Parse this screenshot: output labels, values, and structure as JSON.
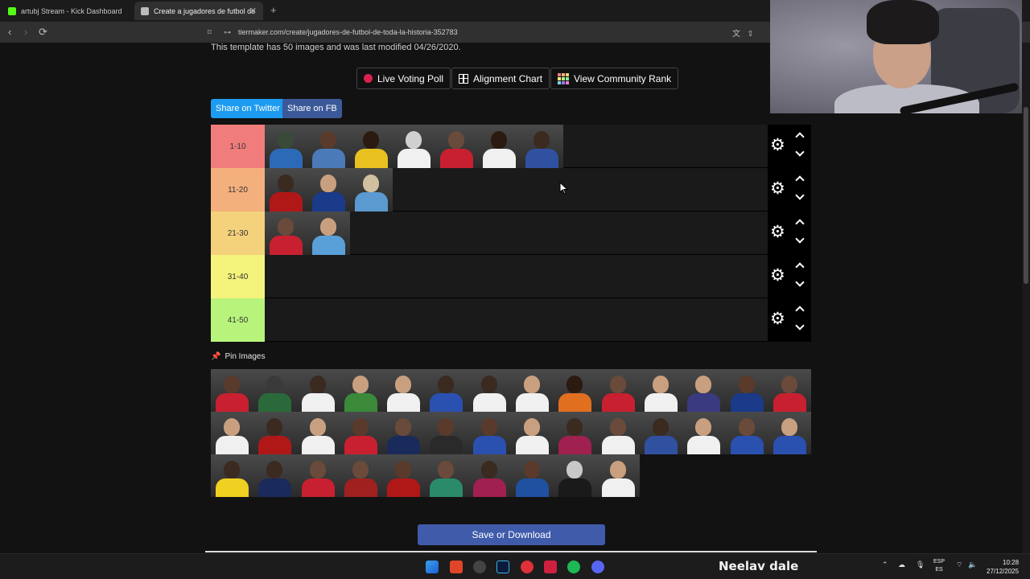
{
  "browser": {
    "tabs": [
      {
        "label": "artubj Stream - Kick Dashboard",
        "active": false,
        "favicon_color": "#53fc18"
      },
      {
        "label": "Create a jugadores de futbol de",
        "active": true,
        "favicon_color": "#bbbbbb"
      }
    ],
    "new_tab": "+",
    "url": "tiermaker.com/create/jugadores-de-futbol-de-toda-la-historia-352783"
  },
  "page": {
    "template_note": "This template has 50 images and was last modified 04/26/2020.",
    "buttons": {
      "live_voting": "Live Voting Poll",
      "alignment_chart": "Alignment Chart",
      "community_rank": "View Community Rank"
    },
    "share": {
      "twitter": "Share on Twitter",
      "facebook": "Share on FB"
    },
    "tiers": [
      {
        "label": "1-10",
        "color": "#f07c7c",
        "items": [
          "#3a4a3a:#2c6ab8",
          "#5a3a2a:#4a7ab8",
          "#2a1a10:#e8c020",
          "#d0d0d0:#f0f0f0",
          "#6a4a3a:#c82030",
          "#2a1a10:#f0f0f0",
          "#3a2a20:#3050a0"
        ]
      },
      {
        "label": "11-20",
        "color": "#f4b07c",
        "items": [
          "#3a2a20:#b01818",
          "#c8a080:#1a3a8a",
          "#d0c0a0:#5a9ad0"
        ]
      },
      {
        "label": "21-30",
        "color": "#f4d27c",
        "items": [
          "#6a4a3a:#c82030",
          "#c8a080:#5aa0d8"
        ]
      },
      {
        "label": "31-40",
        "color": "#f4f47c",
        "items": []
      },
      {
        "label": "41-50",
        "color": "#b8f47c",
        "items": []
      }
    ],
    "pin_images": "Pin Images",
    "pool": [
      "#5a3a2a:#c82030",
      "#3a3a3a:#2a6a3a",
      "#3a2a20:#f0f0f0",
      "#c8a080:#3a8a3a",
      "#c8a080:#f0f0f0",
      "#3a2a20:#2a50b0",
      "#3a2a20:#f0f0f0",
      "#c8a080:#f0f0f0",
      "#2a1a10:#e07020",
      "#6a4a3a:#c82030",
      "#c8a080:#f0f0f0",
      "#c8a080:#3a3a80",
      "#5a3a2a:#1a3a8a",
      "#6a4a3a:#c82030",
      "#c8a080:#f0f0f0",
      "#3a2a20:#b01818",
      "#c8a080:#f0f0f0",
      "#5a3a2a:#c82030",
      "#6a4a3a:#1a2a5a",
      "#5a3a2a:#2a2a2a",
      "#5a3a2a:#2a50b0",
      "#c8a080:#f0f0f0",
      "#3a2a20:#a02050",
      "#6a4a3a:#f0f0f0",
      "#3a2a20:#3050a0",
      "#c8a080:#f0f0f0",
      "#6a4a3a:#2a50b0",
      "#c8a080:#2a50b0",
      "#3a2a20:#f0d020",
      "#3a2a20:#1a2a5a",
      "#6a4a3a:#c82030",
      "#6a4a3a:#a02020",
      "#5a3a2a:#b01818",
      "#6a4a3a:#2a8a6a",
      "#3a2a20:#a02050",
      "#5a3a2a:#2050a0",
      "#c8c8c8:#1a1a1a",
      "#c8a080:#f0f0f0"
    ],
    "save_button": "Save or Download"
  },
  "taskbar": {
    "overlay_text": "Neelav  dale",
    "lang_top": "ESP",
    "lang_bottom": "ES",
    "time": "10:28",
    "date": "27/12/2025"
  }
}
